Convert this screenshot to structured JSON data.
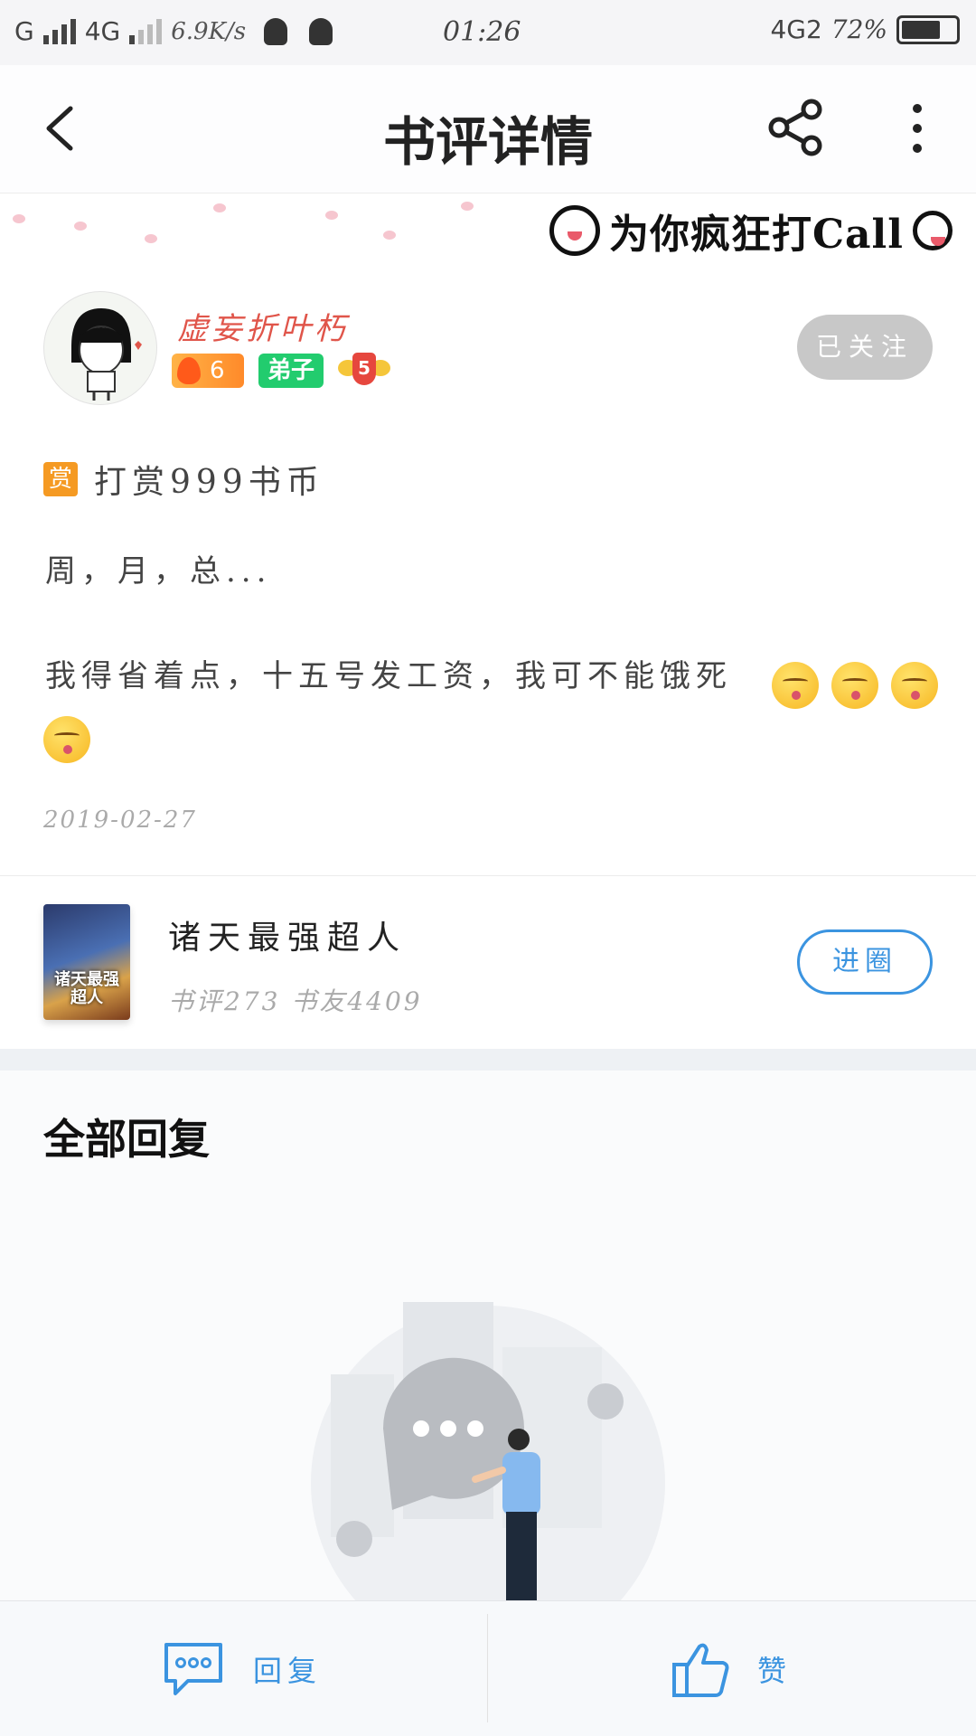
{
  "status_bar": {
    "carrier1": "G",
    "carrier2": "4G",
    "speed": "6.9K/s",
    "time": "01:26",
    "network": "4G2",
    "battery": "72%",
    "battery_level": 0.72
  },
  "header": {
    "title": "书评详情",
    "back_icon": "chevron-left-icon",
    "share_icon": "share-icon",
    "more_icon": "more-vertical-icon"
  },
  "banner": {
    "text": "为你疯狂打Call"
  },
  "user": {
    "name": "虚妄折叶朽",
    "fire_level": "6",
    "title_badge": "弟子",
    "rank_level": "5",
    "follow_label": "已关注"
  },
  "post": {
    "reward_icon": "赏",
    "reward_text": "打赏999书币",
    "line1": "周，月，总...",
    "line2": "我得省着点，十五号发工资，我可不能饿死",
    "emoji_count": 4,
    "date": "2019-02-27"
  },
  "book": {
    "cover_text": "诸天最强超人",
    "title": "诸天最强超人",
    "stats": "书评273  书友4409",
    "enter_label": "进圈"
  },
  "replies": {
    "title": "全部回复"
  },
  "bottom_bar": {
    "reply_label": "回复",
    "like_label": "赞"
  },
  "colors": {
    "accent": "#3b94e0",
    "username": "#e0554a",
    "disciple_badge": "#22cc6e",
    "reward": "#f59a23"
  }
}
